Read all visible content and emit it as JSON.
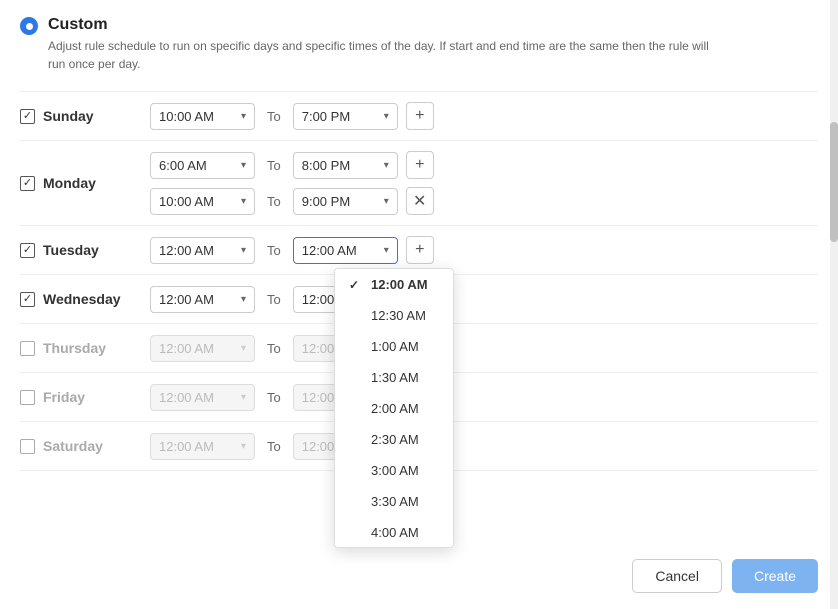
{
  "header": {
    "title": "Custom",
    "description": "Adjust rule schedule to run on specific days and specific times of the day. If start and end time are the same then the rule will run once per day."
  },
  "days": [
    {
      "id": "sunday",
      "label": "Sunday",
      "checked": true,
      "disabled": false,
      "slots": [
        {
          "start": "10:00 AM",
          "end": "7:00 PM",
          "removable": false
        }
      ]
    },
    {
      "id": "monday",
      "label": "Monday",
      "checked": true,
      "disabled": false,
      "slots": [
        {
          "start": "6:00 AM",
          "end": "8:00 PM",
          "removable": false
        },
        {
          "start": "10:00 AM",
          "end": "9:00 PM",
          "removable": true
        }
      ]
    },
    {
      "id": "tuesday",
      "label": "Tuesday",
      "checked": true,
      "disabled": false,
      "slots": [
        {
          "start": "12:00 AM",
          "end": "12:00 AM",
          "removable": false,
          "end_active": true
        }
      ]
    },
    {
      "id": "wednesday",
      "label": "Wednesday",
      "checked": true,
      "disabled": false,
      "slots": [
        {
          "start": "12:00 AM",
          "end": "12:00 AM",
          "removable": false
        }
      ]
    },
    {
      "id": "thursday",
      "label": "Thursday",
      "checked": false,
      "disabled": true,
      "slots": [
        {
          "start": "12:00 AM",
          "end": "12:00 AM",
          "removable": false
        }
      ]
    },
    {
      "id": "friday",
      "label": "Friday",
      "checked": false,
      "disabled": true,
      "slots": [
        {
          "start": "12:00 AM",
          "end": "12:00 AM",
          "removable": false
        }
      ]
    },
    {
      "id": "saturday",
      "label": "Saturday",
      "checked": false,
      "disabled": true,
      "slots": [
        {
          "start": "12:00 AM",
          "end": "12:00 AM",
          "removable": false
        }
      ]
    }
  ],
  "dropdown": {
    "items": [
      {
        "value": "12:00 AM",
        "selected": true
      },
      {
        "value": "12:30 AM",
        "selected": false
      },
      {
        "value": "1:00 AM",
        "selected": false
      },
      {
        "value": "1:30 AM",
        "selected": false
      },
      {
        "value": "2:00 AM",
        "selected": false
      },
      {
        "value": "2:30 AM",
        "selected": false
      },
      {
        "value": "3:00 AM",
        "selected": false
      },
      {
        "value": "3:30 AM",
        "selected": false
      },
      {
        "value": "4:00 AM",
        "selected": false
      }
    ]
  },
  "footer": {
    "cancel_label": "Cancel",
    "create_label": "Create"
  }
}
